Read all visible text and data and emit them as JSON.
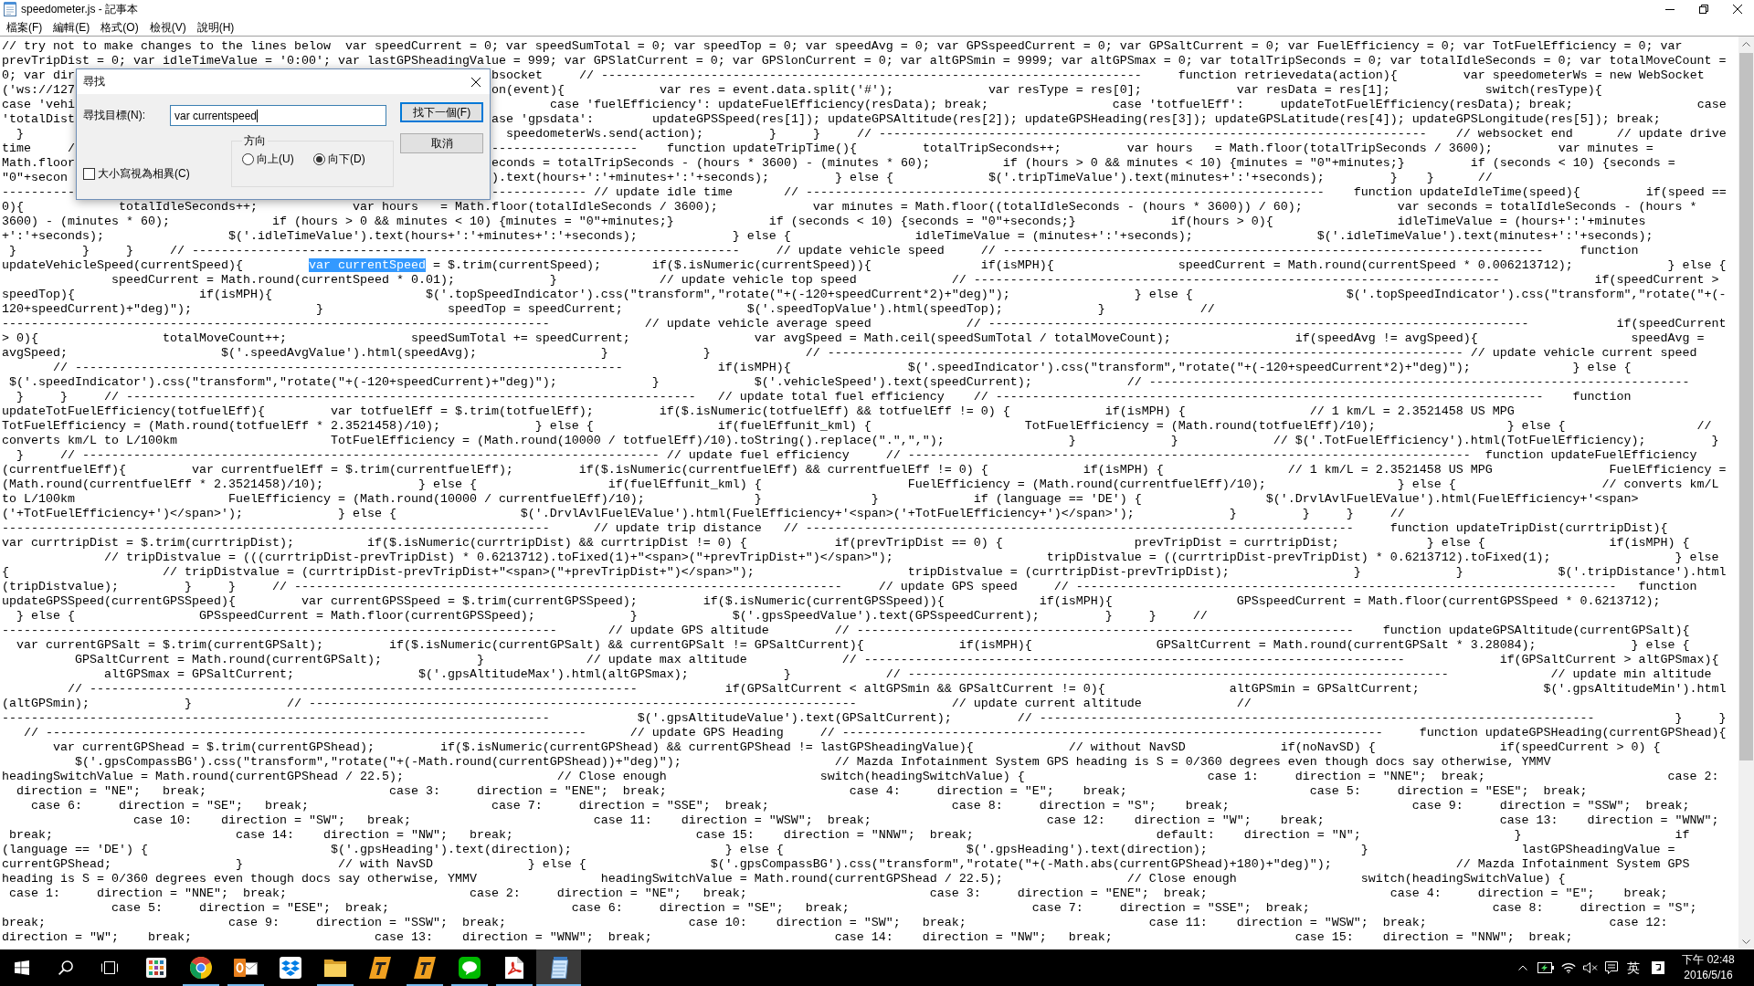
{
  "window": {
    "title": "speedometer.js - 記事本"
  },
  "menu": [
    "檔案(F)",
    "編輯(E)",
    "格式(O)",
    "檢視(V)",
    "說明(H)"
  ],
  "editor": {
    "lines": [
      {
        "kind": "plain",
        "text": "// try not to make changes to the lines below  var speedCurrent = 0; var speedSumTotal = 0; var speedTop = 0; var speedAvg = 0; var GPSspeedCurrent = 0; var GPSaltCurrent = 0; var FuelEfficiency = 0; var TotFuelEfficiency = 0; var"
      },
      {
        "kind": "plain",
        "text": "prevTripDist = 0; var idleTimeValue = '0:00'; var lastGPSheadingValue = 999; var GPSlatCurrent = 0; var GPSlonCurrent = 0; var altGPSmin = 9999; var altGPSmax = 0; var totalTripSeconds = 0; var totalIdleSeconds = 0; var totalMoveCount ="
      },
      {
        "kind": "covered",
        "left": "0; var dir",
        "right": "bsocket     // --------------------------------------------------------------------------     function retrievedata(action){         var speedometerWs = new WebSocket"
      },
      {
        "kind": "covered",
        "left": "('ws://127",
        "right": "on(event){             var res = event.data.split('#');             var resType = res[0];             var resData = res[1];             switch(resType){"
      },
      {
        "kind": "covered",
        "left": "case 'vehi",
        "right": "        case 'fuelEfficiency': updateFuelEfficiency(resData); break;                 case 'totfuelEff':     updateTotFuelEfficiency(resData); break;                 case"
      },
      {
        "kind": "covered",
        "left": "'totalDist",
        "right": "ase 'gpsdata':        updateGPSSpeed(res[1]); updateGPSAltitude(res[2]); updateGPSHeading(res[3]); updateGPSLatitude(res[4]); updateGPSLongitude(res[5]); break;"
      },
      {
        "kind": "covered",
        "left": "  }",
        "right": "  speedometerWs.send(action);         }     }     // ---------------------------------------------------------------------------    // websocket end      // update drive"
      },
      {
        "kind": "covered",
        "left": "time     /",
        "right": "--------------------    function updateTripTime(){         totalTripSeconds++;         var hours   = Math.floor(totalTripSeconds / 3600);         var minutes ="
      },
      {
        "kind": "covered",
        "left": "Math.floor",
        "right": "econds = totalTripSeconds - (hours * 3600) - (minutes * 60);          if (hours > 0 && minutes < 10) {minutes = \"0\"+minutes;}         if (seconds < 10) {seconds ="
      },
      {
        "kind": "covered",
        "left": "\"0\"+secon",
        "right": ").text(hours+':'+minutes+':'+seconds);         } else {             $('.tripTimeValue').text(minutes+':'+seconds);         }    }      //"
      },
      {
        "kind": "covered",
        "left": "----------",
        "right": "------------- // update idle time       // -----------------------------------------------------------------------    function updateIdleTime(speed){         if(speed =="
      },
      {
        "kind": "plain",
        "text": "0){             totalIdleSeconds++;             var hours   = Math.floor(totalIdleSeconds / 3600);             var minutes = Math.floor((totalIdleSeconds - (hours * 3600)) / 60);             var seconds = totalIdleSeconds - (hours *"
      },
      {
        "kind": "plain",
        "text": "3600) - (minutes * 60);              if (hours > 0 && minutes < 10) {minutes = \"0\"+minutes;}             if (seconds < 10) {seconds = \"0\"+seconds;}             if(hours > 0){                 idleTimeValue = (hours+':'+minutes"
      },
      {
        "kind": "plain",
        "text": "+':'+seconds);                 $('.idleTimeValue').text(hours+':'+minutes+':'+seconds);             } else {                 idleTimeValue = (minutes+':'+seconds);                 $('.idleTimeValue').text(minutes+':'+seconds);"
      },
      {
        "kind": "plain",
        "text": " }         }     }     // ---------------------------------------------------------------------------     // update vehicle speed     // --------------------------------------------------------------------------     function"
      },
      {
        "kind": "selection",
        "before": "updateVehicleSpeed(currentSpeed){         ",
        "selection": "var currentSpeed",
        "after": " = $.trim(currentSpeed);       if($.isNumeric(currentSpeed)){               if(isMPH){                 speedCurrent = Math.round(currentSpeed * 0.006213712);             } else {"
      },
      {
        "kind": "plain",
        "text": "               speedCurrent = Math.round(currentSpeed * 0.01);             }              // update vehicle top speed             // ------------------------------------------------------------------------             if(speedCurrent >"
      },
      {
        "kind": "plain",
        "text": "speedTop){                 if(isMPH){                     $('.topSpeedIndicator').css(\"transform\",\"rotate(\"+(-120+speedCurrent*2)+\"deg)\");                 } else {                     $('.topSpeedIndicator').css(\"transform\",\"rotate(\"+(-"
      },
      {
        "kind": "plain",
        "text": "120+speedCurrent)+\"deg)\");                 }                 speedTop = speedCurrent;                 $('.speedTopValue').html(speedTop);             }             //"
      },
      {
        "kind": "plain",
        "text": "---------------------------------------------------------------------------             // update vehicle average speed             // --------------------------------------------------------------------------            if(speedCurrent"
      },
      {
        "kind": "plain",
        "text": "> 0){                 totalMoveCount++;                 speedSumTotal += speedCurrent;                 var avgSpeed = Math.ceil(speedSumTotal / totalMoveCount);                 if(speedAvg != avgSpeed){                     speedAvg ="
      },
      {
        "kind": "plain",
        "text": "avgSpeed;                     $('.speedAvgValue').html(speedAvg);                 }             }             // --------------------------------------------------------------------------------------- // update vehicle current speed"
      },
      {
        "kind": "plain",
        "text": "       // ---------------------------------------------------------------------------             if(isMPH){                $('.speedIndicator').css(\"transform\",\"rotate(\"+(-120+speedCurrent*2)+\"deg)\");              } else {"
      },
      {
        "kind": "plain",
        "text": " $('.speedIndicator').css(\"transform\",\"rotate(\"+(-120+speedCurrent)+\"deg)\");             }             $('.vehicleSpeed').text(speedCurrent);             // --------------------------------------------------------------------------"
      },
      {
        "kind": "plain",
        "text": "  }     }     // ------------------------------------------------------------------------------   // update total fuel efficiency    // ---------------------------------------------------------------------------    function"
      },
      {
        "kind": "plain",
        "text": "updateTotFuelEfficiency(totfuelEff){         var totfuelEff = $.trim(totfuelEff);         if($.isNumeric(totfuelEff) && totfuelEff != 0) {             if(isMPH) {                 // 1 km/L = 2.3521458 US MPG"
      },
      {
        "kind": "plain",
        "text": "TotFuelEfficiency = (Math.round(totfuelEff * 2.3521458)/10);             } else {                 if(fuelEffunit_kml) {                     TotFuelEfficiency = (Math.round(totfuelEff)/10);                  } else {                  //"
      },
      {
        "kind": "plain",
        "text": "converts km/L to L/100km                     TotFuelEfficiency = (Math.round(10000 / totfuelEff)/10).toString().replace(\".\",\",\");                 }             }             // $('.TotFuelEfficiency').html(TotFuelEfficiency);         }"
      },
      {
        "kind": "plain",
        "text": "  }     // ------------------------------------------------------------------------------- // update fuel efficiency     // -----------------------------------------------------------------------------  function updateFuelEfficiency"
      },
      {
        "kind": "plain",
        "text": "(currentfuelEff){         var currentfuelEff = $.trim(currentfuelEff);         if($.isNumeric(currentfuelEff) && currentfuelEff != 0) {             if(isMPH) {                 // 1 km/L = 2.3521458 US MPG                FuelEfficiency ="
      },
      {
        "kind": "plain",
        "text": "(Math.round(currentfuelEff * 2.3521458)/10);             } else {                  if(fuelEffunit_kml) {                    FuelEfficiency = (Math.round(currentfuelEff)/10);                  } else {                    // converts km/L"
      },
      {
        "kind": "plain",
        "text": "to L/100km                     FuelEfficiency = (Math.round(10000 / currentfuelEff)/10);               }               }             if (language == 'DE') {                 $('.DrvlAvlFuelEValue').html(FuelEfficiency+'<span>"
      },
      {
        "kind": "plain",
        "text": "('+TotFuelEfficiency+')</span>');             } else {                 $('.DrvlAvlFuelEValue').html(FuelEfficiency+'<span>('+TotFuelEfficiency+')</span>');             }         }     }     //"
      },
      {
        "kind": "plain",
        "text": "---------------------------------------------------------------------------      // update trip distance   // ---------------------------------------------------------------------------     function updateTripDist(currtripDist){"
      },
      {
        "kind": "plain",
        "text": "var currtripDist = $.trim(currtripDist);          if($.isNumeric(currtripDist) && currtripDist != 0) {            if(prevTripDist == 0) {                  prevTripDist = currtripDist;            } else {                 if(isMPH) {"
      },
      {
        "kind": "plain",
        "text": "              // tripDistvalue = (((currtripDist-prevTripDist) * 0.6213712).toFixed(1)+\"<span>(\"+prevTripDist+\")</span>\");                     tripDistvalue = ((currtripDist-prevTripDist) * 0.6213712).toFixed(1);                 } else"
      },
      {
        "kind": "plain",
        "text": "{                     // tripDistvalue = (currtripDist-prevTripDist+\"<span>(\"+prevTripDist+\")</span>\");                     tripDistvalue = (currtripDist-prevTripDist);                 }             }             $('.tripDistance').html"
      },
      {
        "kind": "plain",
        "text": "(tripDistvalue);         }     }     // ---------------------------------------------------------------------------     // update GPS speed     // --------------------------------------------------------------------------   function"
      },
      {
        "kind": "plain",
        "text": "updateGPSSpeed(currentGPSSpeed){         var currentGPSSpeed = $.trim(currentGPSSpeed);         if($.isNumeric(currentGPSSpeed)){             if(isMPH){                 GPSspeedCurrent = Math.floor(currentGPSSpeed * 0.6213712);"
      },
      {
        "kind": "plain",
        "text": "  } else {                 GPSspeedCurrent = Math.floor(currentGPSSpeed);             }             $('.gpsSpeedValue').text(GPSspeedCurrent);         }     }     //"
      },
      {
        "kind": "plain",
        "text": "----------------------------------------------------------------------------       // update GPS altitude         // --------------------------------------------------------------------    function updateGPSAltitude(currentGPSalt){"
      },
      {
        "kind": "plain",
        "text": "  var currentGPSalt = $.trim(currentGPSalt);         if($.isNumeric(currentGPSalt) && currentGPSalt != GPSaltCurrent){             if(isMPH){                 GPSaltCurrent = Math.round(currentGPSalt * 3.28084);             } else {"
      },
      {
        "kind": "plain",
        "text": "          GPSaltCurrent = Math.round(currentGPSalt);             }              // update max altitude             // --------------------------------------------------------------------------             if(GPSaltCurrent > altGPSmax){"
      },
      {
        "kind": "plain",
        "text": "              altGPSmax = GPSaltCurrent;                 $('.gpsAltitudeMax').html(altGPSmax);             }             // --------------------------------------------------------------------------              // update min altitude"
      },
      {
        "kind": "plain",
        "text": "         // ---------------------------------------------------------------------------            if(GPSaltCurrent < altGPSmin && GPSaltCurrent != 0){                 altGPSmin = GPSaltCurrent;                 $('.gpsAltitudeMin').html"
      },
      {
        "kind": "plain",
        "text": "(altGPSmin);             }             // ---------------------------------------------------------------------------             // update current altitude             //"
      },
      {
        "kind": "plain",
        "text": "---------------------------------------------------------------------------            $('.gpsAltitudeValue').text(GPSaltCurrent);         // ----------------------------------------------------------------------------           }     }"
      },
      {
        "kind": "plain",
        "text": "   // --------------------------------------------------------------------------      // update GPS Heading     // --------------------------------------------------------------------------     function updateGPSHeading(currentGPShead){"
      },
      {
        "kind": "plain",
        "text": "       var currentGPShead = $.trim(currentGPShead);         if($.isNumeric(currentGPShead) && currentGPShead != lastGPSheadingValue){             // without NavSD             if(noNavSD) {                 if(speedCurrent > 0) {"
      },
      {
        "kind": "plain",
        "text": "          $('.gpsCompassBG').css(\"transform\",\"rotate(\"+(-Math.round(currentGPShead))+\"deg)\");                     // Mazda Infotainment System GPS heading is S = 0/360 degrees even though docs say otherwise, YMMV"
      },
      {
        "kind": "plain",
        "text": "headingSwitchValue = Math.round(currentGPShead / 22.5);                     // Close enough                     switch(headingSwitchValue) {                         case 1:     direction = \"NNE\";  break;                         case 2:"
      },
      {
        "kind": "plain",
        "text": "  direction = \"NE\";   break;                         case 3:     direction = \"ENE\";  break;                         case 4:     direction = \"E\";    break;                         case 5:     direction = \"ESE\";  break;"
      },
      {
        "kind": "plain",
        "text": "    case 6:     direction = \"SE\";   break;                         case 7:     direction = \"SSE\";  break;                         case 8:     direction = \"S\";    break;                         case 9:     direction = \"SSW\";  break;"
      },
      {
        "kind": "plain",
        "text": "                  case 10:    direction = \"SW\";   break;                         case 11:    direction = \"WSW\";  break;                        case 12:    direction = \"W\";    break;                        case 13:    direction = \"WNW\";"
      },
      {
        "kind": "plain",
        "text": " break;                         case 14:    direction = \"NW\";   break;                         case 15:    direction = \"NNW\";  break;                         default:    direction = \"N\";                     }                     if"
      },
      {
        "kind": "plain",
        "text": "(language == 'DE') {                         $('.gpsHeading').text(direction);                     } else {                         $('.gpsHeading').text(direction);                     }                     lastGPSheadingValue ="
      },
      {
        "kind": "plain",
        "text": "currentGPShead;                 }             // with NavSD             } else {                 $('.gpsCompassBG').css(\"transform\",\"rotate(\"+(-Math.abs(currentGPShead)+180)+\"deg)\");                 // Mazda Infotainment System GPS"
      },
      {
        "kind": "plain",
        "text": "heading is S = 0/360 degrees even though docs say otherwise, YMMV                 headingSwitchValue = Math.round(currentGPShead / 22.5);                 // Close enough                 switch(headingSwitchValue) {"
      },
      {
        "kind": "plain",
        "text": " case 1:     direction = \"NNE\";  break;                         case 2:     direction = \"NE\";   break;                         case 3:     direction = \"ENE\";  break;                         case 4:     direction = \"E\";    break;"
      },
      {
        "kind": "plain",
        "text": "               case 5:     direction = \"ESE\";  break;                         case 6:     direction = \"SE\";   break;                         case 7:     direction = \"SSE\";  break;                         case 8:     direction = \"S\";"
      },
      {
        "kind": "plain",
        "text": "break;                         case 9:     direction = \"SSW\";  break;                         case 10:    direction = \"SW\";   break;                         case 11:    direction = \"WSW\";  break;                         case 12:"
      },
      {
        "kind": "plain",
        "text": "direction = \"W\";    break;                         case 13:    direction = \"WNW\";  break;                         case 14:    direction = \"NW\";   break;                         case 15:    direction = \"NNW\";  break;"
      }
    ]
  },
  "find_dialog": {
    "title": "尋找",
    "find_label": "尋找目標(N):",
    "find_value": "var currentspeed",
    "find_next": "找下一個(F)",
    "cancel": "取消",
    "direction": {
      "label": "方向",
      "options": [
        {
          "label": "向上(U)",
          "selected": false
        },
        {
          "label": "向下(D)",
          "selected": true
        }
      ]
    },
    "match_case": {
      "label": "大小寫視為相異(C)",
      "checked": false
    }
  },
  "taskbar": {
    "apps": [
      {
        "kind": "grid",
        "running": false,
        "selected": false
      },
      {
        "kind": "browser",
        "running": true,
        "selected": false
      },
      {
        "kind": "mail",
        "running": true,
        "selected": false
      },
      {
        "kind": "box",
        "running": false,
        "selected": false
      },
      {
        "kind": "folder",
        "running": true,
        "selected": false
      },
      {
        "kind": "tile",
        "running": false,
        "selected": false
      },
      {
        "kind": "tile",
        "running": true,
        "selected": false
      },
      {
        "kind": "chat",
        "running": true,
        "selected": false
      },
      {
        "kind": "pdf",
        "running": true,
        "selected": false
      },
      {
        "kind": "notepad",
        "running": true,
        "selected": true
      }
    ],
    "tray": {
      "ime": "英",
      "time": "下午 02:48",
      "date": "2016/5/16"
    }
  }
}
